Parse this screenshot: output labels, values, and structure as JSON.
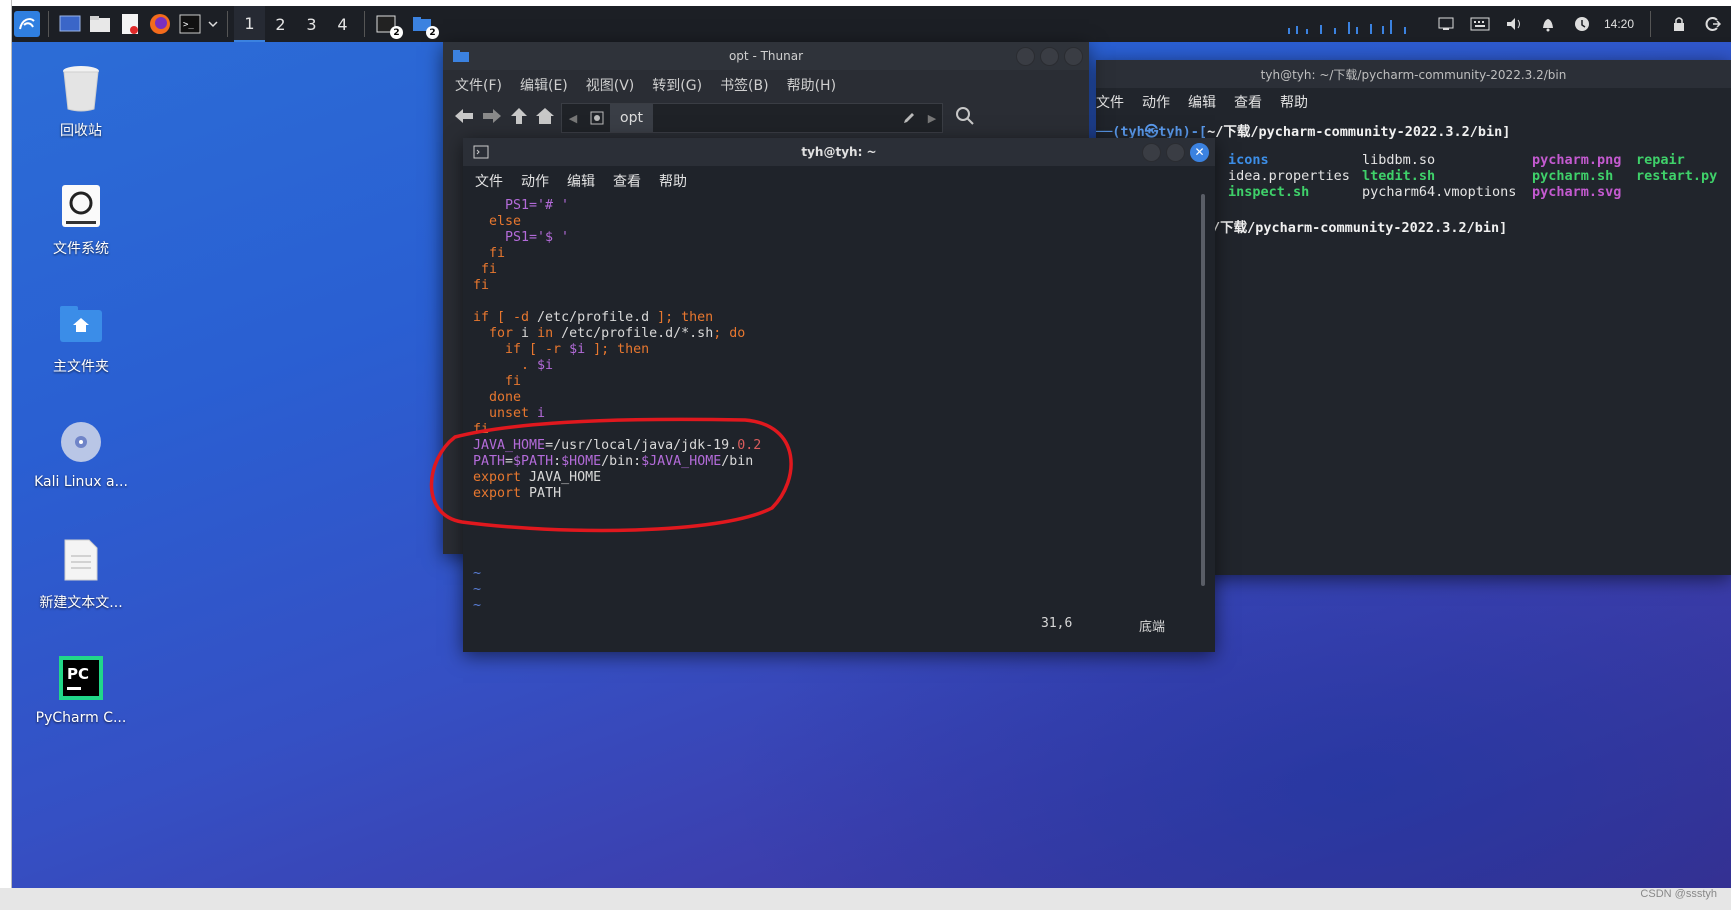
{
  "taskbar": {
    "workspaces": [
      "1",
      "2",
      "3",
      "4"
    ],
    "active_workspace": "1",
    "terminal_badge": "2",
    "files_badge": "2",
    "clock": "14:20"
  },
  "desktop_icons": [
    {
      "label": "回收站",
      "icon": "trash-icon"
    },
    {
      "label": "文件系统",
      "icon": "drive-icon"
    },
    {
      "label": "主文件夹",
      "icon": "home-folder-icon"
    },
    {
      "label": "Kali Linux a...",
      "icon": "disc-icon"
    },
    {
      "label": "新建文本文...",
      "icon": "text-file-icon"
    },
    {
      "label": "PyCharm C...",
      "icon": "pycharm-icon"
    }
  ],
  "back_terminal": {
    "title": "tyh@tyh: ~/下载/pycharm-community-2022.3.2/bin",
    "menu": [
      "文件",
      "动作",
      "编辑",
      "查看",
      "帮助"
    ],
    "prompt_path": "~/下载/pycharm-community-2022.3.2/bin]",
    "prompt_user": "(tyh㉿tyh)",
    "files_row1": [
      "icons",
      "libdbm.so",
      "pycharm.png",
      "repair"
    ],
    "files_row2": [
      "idea.properties",
      "ltedit.sh",
      "pycharm.sh",
      "restart.py"
    ],
    "files_row3": [
      "inspect.sh",
      "pycharm64.vmoptions",
      "pycharm.svg"
    ],
    "prompt2_path": "/下载/pycharm-community-2022.3.2/bin]"
  },
  "thunar": {
    "title": "opt - Thunar",
    "menu": [
      "文件(F)",
      "编辑(E)",
      "视图(V)",
      "转到(G)",
      "书签(B)",
      "帮助(H)"
    ],
    "location": "opt"
  },
  "front_terminal": {
    "title": "tyh@tyh: ~",
    "menu": [
      "文件",
      "动作",
      "编辑",
      "查看",
      "帮助"
    ],
    "status_pos": "31,6",
    "status_mode": "底端",
    "code": {
      "l1": "    PS1='# '",
      "l2": "  else",
      "l3": "    PS1='$ '",
      "l4": "  fi",
      "l5": " fi",
      "l6": "fi",
      "l7": "",
      "l8_a": "if [ -d ",
      "l8_b": "/etc/profile.d",
      "l8_c": " ]; then",
      "l9_a": "  for ",
      "l9_b": "i",
      "l9_c": " in ",
      "l9_d": "/etc/profile.d/*.sh",
      "l9_e": "; do",
      "l10_a": "    if [ -r ",
      "l10_b": "$i",
      "l10_c": " ]; then",
      "l11_a": "      . ",
      "l11_b": "$i",
      "l12": "    fi",
      "l13": "  done",
      "l14_a": "  unset ",
      "l14_b": "i",
      "l15": "fi",
      "l16_a": "JAVA_HOME",
      "l16_b": "=/usr/local/java/jdk-19.",
      "l16_c": "0.2",
      "l17_a": "PATH",
      "l17_b": "=",
      "l17_c": "$PATH",
      "l17_d": ":",
      "l17_e": "$HOME",
      "l17_f": "/bin:",
      "l17_g": "$JAVA_HOME",
      "l17_h": "/bin",
      "l18_a": "export",
      "l18_b": " JAVA_HOME",
      "l19_a": "export",
      "l19_b": " PATH",
      "tilde": "~"
    }
  },
  "watermark": "CSDN @ssstyh",
  "colors": {
    "annotation_circle": "#e0181e",
    "accent": "#3b82e0",
    "terminal_bg": "#1f232a"
  }
}
